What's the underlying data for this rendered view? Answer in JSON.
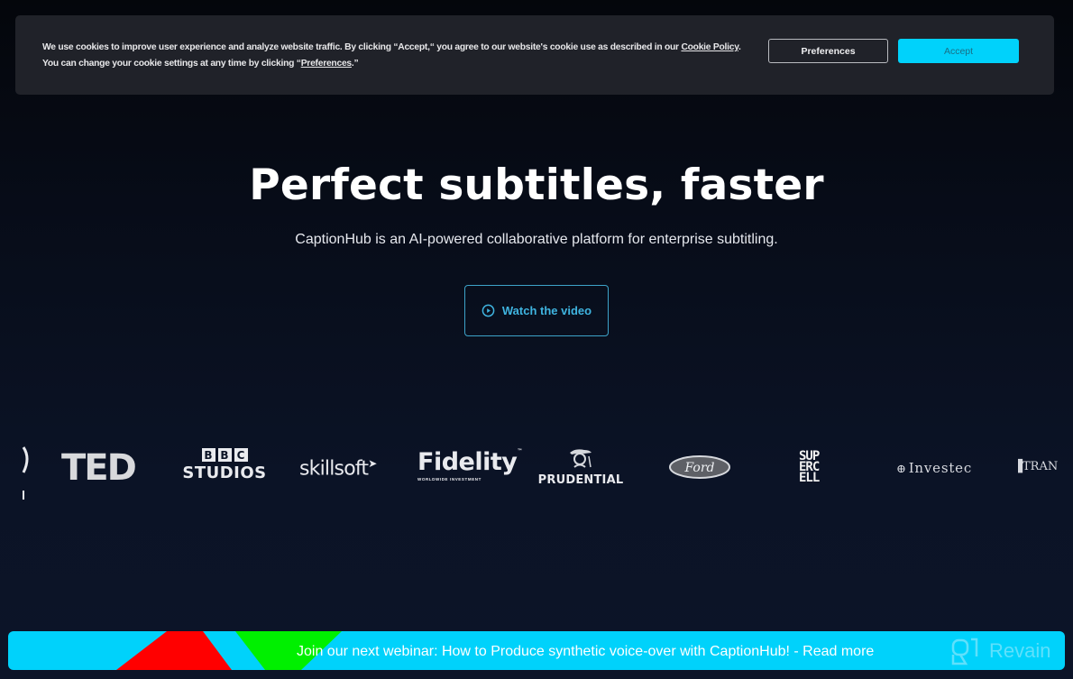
{
  "cookie_banner": {
    "text_before_policy": "We use cookies to improve user experience and analyze website traffic. By clicking “Accept,“ you agree to our website's cookie use as described in our ",
    "policy_link": "Cookie Policy",
    "text_after_policy": ". You can change your cookie settings at any time by clicking “",
    "preferences_link": "Preferences",
    "text_end": ".”",
    "preferences_button": "Preferences",
    "accept_button": "Accept"
  },
  "hero": {
    "title": "Perfect subtitles, faster",
    "subtitle": "CaptionHub is an AI-powered collaborative platform for enterprise subtitling.",
    "watch_button": "Watch the video",
    "watch_icon": "play-circle-icon"
  },
  "logos": {
    "ted": "TED",
    "bbc_letters": [
      "B",
      "B",
      "C"
    ],
    "bbc_studios": "STUDIOS",
    "skillsoft": "skillsoft",
    "fidelity": "Fidelity",
    "fidelity_tm": "™",
    "fidelity_sub": "WORLDWIDE INVESTMENT",
    "prudential": "PRUDENTIAL",
    "ford": "Ford",
    "supercell": [
      "SUP",
      "ERC",
      "ELL"
    ],
    "investec": "Investec",
    "tran": "TRAN"
  },
  "webinar": {
    "text": "Join our next webinar: How to Produce synthetic voice-over with CaptionHub! - ",
    "link": "Read more"
  },
  "watermark": {
    "label": "Revain"
  },
  "colors": {
    "accent": "#00d2fb",
    "background": "#0b1326",
    "cookie_bg": "#202229",
    "watch_button": "#3fb4e0"
  }
}
